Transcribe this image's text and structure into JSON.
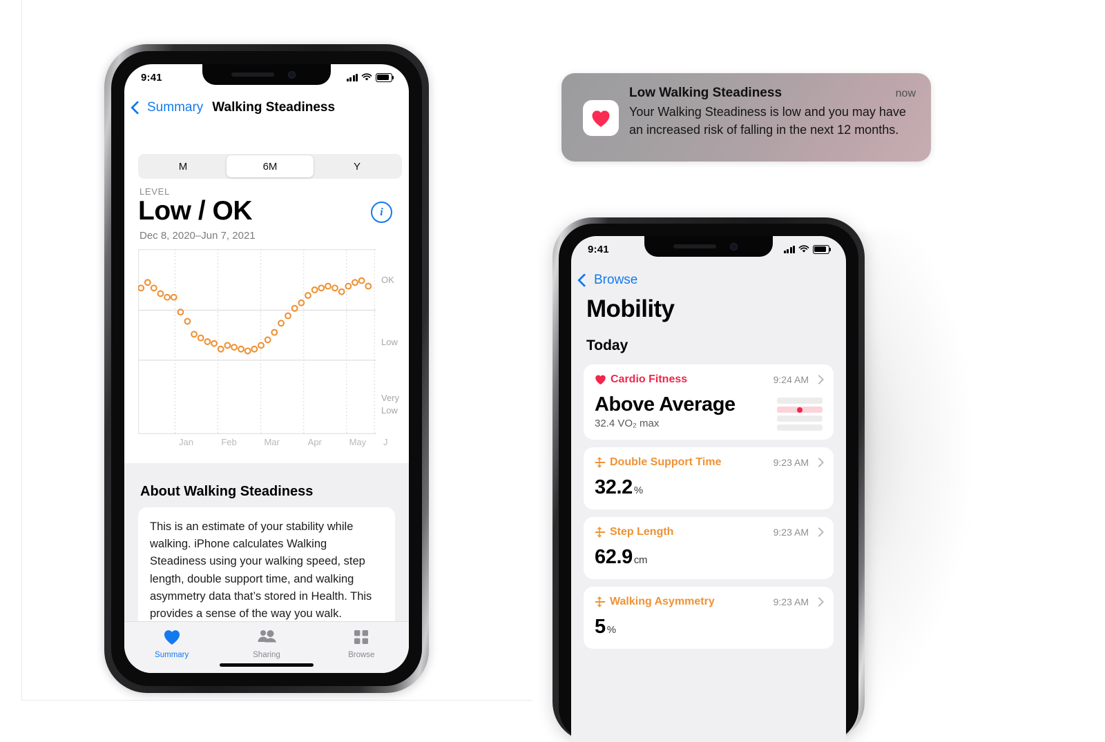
{
  "theme": {
    "accent_blue": "#1479ef",
    "accent_orange": "#ee9234",
    "accent_red": "#f0264c",
    "bg_grouped": "#f0f0f3"
  },
  "phone_left": {
    "status_bar": {
      "time": "9:41",
      "cellular_icon": "signal-bars-icon",
      "wifi_icon": "wifi-icon",
      "battery_icon": "battery-icon"
    },
    "nav": {
      "back_label": "Summary",
      "back_icon": "chevron-left-icon",
      "title": "Walking Steadiness"
    },
    "segmented_control": {
      "options": [
        "M",
        "6M",
        "Y"
      ],
      "selected": "6M"
    },
    "level": {
      "caption": "LEVEL",
      "value": "Low / OK",
      "date_range": "Dec 8, 2020–Jun 7, 2021",
      "info_icon": "info-circle-icon"
    },
    "about": {
      "heading": "About Walking Steadiness",
      "body": "This is an estimate of your stability while walking. iPhone calculates Walking Steadiness using your walking speed, step length, double support time, and walking asymmetry data that’s stored in Health. This provides a sense of the way you walk."
    },
    "tab_bar": {
      "tabs": [
        {
          "label": "Summary",
          "icon": "heart-icon",
          "active": true
        },
        {
          "label": "Sharing",
          "icon": "people-icon",
          "active": false
        },
        {
          "label": "Browse",
          "icon": "grid-icon",
          "active": false
        }
      ]
    }
  },
  "notification": {
    "app_icon": "health-heart-icon",
    "title": "Low Walking Steadiness",
    "timestamp": "now",
    "body": "Your Walking Steadiness is low and you may have an increased risk of falling in the next 12 months."
  },
  "phone_right": {
    "status_bar": {
      "time": "9:41",
      "cellular_icon": "signal-bars-icon",
      "wifi_icon": "wifi-icon",
      "battery_icon": "battery-icon"
    },
    "nav": {
      "back_label": "Browse",
      "back_icon": "chevron-left-icon"
    },
    "page_title": "Mobility",
    "section_title": "Today",
    "cards": [
      {
        "icon": "heart-icon",
        "icon_color": "#f0264c",
        "name": "Cardio Fitness",
        "name_color": "#f0264c",
        "time": "9:24 AM",
        "value": "Above Average",
        "unit": "",
        "subtitle": "32.4 VO₂ max",
        "has_range_graphic": true
      },
      {
        "icon": "mobility-icon",
        "icon_color": "#ee9234",
        "name": "Double Support Time",
        "name_color": "#ee9234",
        "time": "9:23 AM",
        "value": "32.2",
        "unit": "%",
        "subtitle": "",
        "has_range_graphic": false
      },
      {
        "icon": "mobility-icon",
        "icon_color": "#ee9234",
        "name": "Step Length",
        "name_color": "#ee9234",
        "time": "9:23 AM",
        "value": "62.9",
        "unit": "cm",
        "subtitle": "",
        "has_range_graphic": false
      },
      {
        "icon": "mobility-icon",
        "icon_color": "#ee9234",
        "name": "Walking Asymmetry",
        "name_color": "#ee9234",
        "time": "9:23 AM",
        "value": "5",
        "unit": "%",
        "subtitle": "",
        "has_range_graphic": false
      }
    ]
  },
  "chart_data": {
    "type": "scatter",
    "title": "Walking Steadiness",
    "subtitle": "Dec 8, 2020–Jun 7, 2021",
    "xlabel": "",
    "ylabel": "",
    "grid": true,
    "legend_position": "none",
    "marker": "open-circle",
    "marker_color": "#ee9234",
    "xtick_labels": [
      "Jan",
      "Feb",
      "Mar",
      "Apr",
      "May",
      "J"
    ],
    "xtick_positions": [
      0.155,
      0.335,
      0.515,
      0.695,
      0.875,
      0.992
    ],
    "ytick_labels": [
      "OK",
      "Low",
      "Very Low"
    ],
    "ylim": [
      0,
      100
    ],
    "y_band_boundaries": [
      67,
      40
    ],
    "x": [
      0.012,
      0.04,
      0.066,
      0.094,
      0.122,
      0.15,
      0.178,
      0.207,
      0.235,
      0.263,
      0.291,
      0.319,
      0.347,
      0.375,
      0.403,
      0.432,
      0.46,
      0.488,
      0.516,
      0.544,
      0.572,
      0.6,
      0.629,
      0.657,
      0.685,
      0.713,
      0.741,
      0.769,
      0.797,
      0.826,
      0.854,
      0.882,
      0.91,
      0.938,
      0.966
    ],
    "y": [
      79,
      82,
      79,
      76,
      74,
      74,
      66,
      61,
      54,
      52,
      50,
      49,
      46,
      48,
      47,
      46,
      45,
      46,
      48,
      51,
      55,
      60,
      64,
      68,
      71,
      75,
      78,
      79,
      80,
      79,
      77,
      80,
      82,
      83,
      80
    ],
    "values_note": "y is percent of plot height: OK band above 67, Low band 40-67, Very Low band below 40"
  }
}
